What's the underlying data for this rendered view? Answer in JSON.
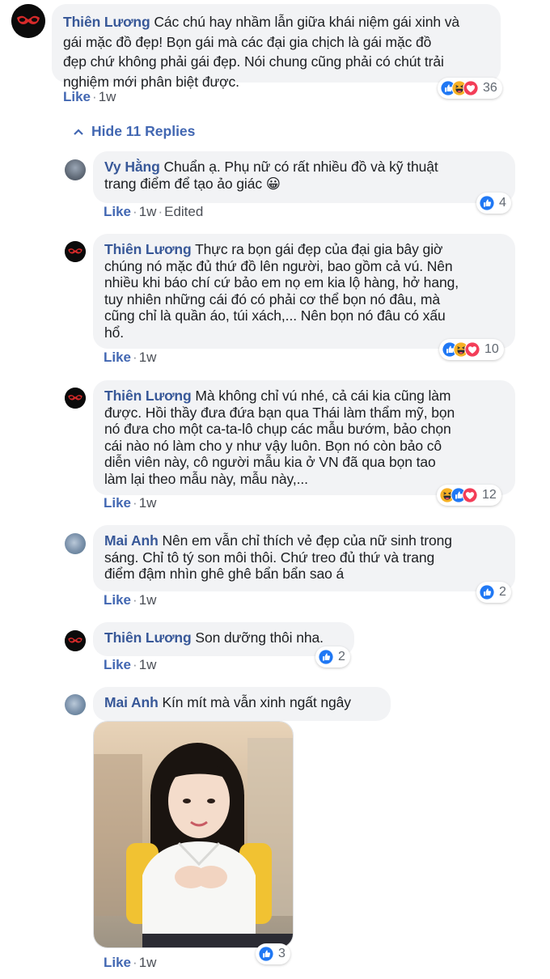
{
  "top_comment": {
    "author": "Thiên Lương",
    "text": "Các chú hay nhầm lẫn giữa khái niệm gái xinh và gái mặc đồ đẹp! Bọn gái mà các đại gia chịch là gái mặc đồ đẹp chứ không phải gái đẹp. Nói chung cũng phải có chút trải nghiệm mới phân biệt được.",
    "lines": [
      "Các chú hay nhầm lẫn giữa khái niệm gái xinh và",
      "gái mặc đồ đẹp! Bọn gái mà các đại gia chịch là gái mặc đồ",
      "đẹp chứ không phải gái đẹp. Nói chung cũng phải có chút trải",
      "nghiệm mới phân biệt được."
    ],
    "like_label": "Like",
    "time": "1w",
    "reactions": [
      "like-icon",
      "haha-icon",
      "love-icon"
    ],
    "reaction_count": "36"
  },
  "hide_replies_label": "Hide 11 Replies",
  "replies": [
    {
      "author": "Vy Hằng",
      "lines": [
        "Chuẩn ạ. Phụ nữ có rất nhiều đồ và kỹ thuật",
        "trang điểm để tạo ảo giác 😀"
      ],
      "like_label": "Like",
      "time": "1w",
      "edited_label": "Edited",
      "reactions": [
        "like-icon"
      ],
      "reaction_count": "4"
    },
    {
      "author": "Thiên Lương",
      "lines": [
        "Thực ra bọn gái đẹp của đại gia bây giờ",
        "chúng nó mặc đủ thứ đồ lên người, bao gồm cả vú. Nên",
        "nhiều khi báo chí cứ bảo em nọ em kia lộ hàng, hở hang,",
        "tuy nhiên những cái đó có phải cơ thể bọn nó đâu, mà",
        "cũng chỉ là quần áo, túi xách,... Nên bọn nó đâu có xấu",
        "hổ."
      ],
      "like_label": "Like",
      "time": "1w",
      "reactions": [
        "like-icon",
        "haha-icon",
        "love-icon"
      ],
      "reaction_count": "10"
    },
    {
      "author": "Thiên Lương",
      "lines": [
        "Mà không chỉ vú nhé, cả cái kia cũng làm",
        "được. Hồi thầy đưa đứa bạn qua Thái làm thẩm mỹ, bọn",
        "nó đưa cho một ca-ta-lô chụp các mẫu bướm, bảo chọn",
        "cái nào nó làm cho y như vậy luôn. Bọn nó còn bảo cô",
        "diễn viên này, cô người mẫu kia ở VN đã qua bọn tao",
        "làm lại theo mẫu này, mẫu này,..."
      ],
      "like_label": "Like",
      "time": "1w",
      "reactions": [
        "haha-icon",
        "like-icon",
        "love-icon"
      ],
      "reaction_count": "12"
    },
    {
      "author": "Mai Anh",
      "lines": [
        "Nên em vẫn chỉ thích vẻ đẹp của nữ sinh trong",
        "sáng. Chỉ tô tý son môi thôi. Chứ treo đủ thứ và trang",
        "điểm đậm nhìn ghê ghê bẩn bẩn sao á"
      ],
      "like_label": "Like",
      "time": "1w",
      "reactions": [
        "like-icon"
      ],
      "reaction_count": "2"
    },
    {
      "author": "Thiên Lương",
      "lines": [
        "Son dưỡng thôi nha."
      ],
      "like_label": "Like",
      "time": "1w",
      "reactions": [
        "like-icon"
      ],
      "reaction_count": "2"
    },
    {
      "author": "Mai Anh",
      "lines": [
        "Kín mít mà vẫn xinh ngất ngây"
      ],
      "like_label": "Like",
      "time": "1w",
      "reactions": [
        "like-icon"
      ],
      "reaction_count": "3"
    }
  ],
  "colors": {
    "name": "#385898",
    "link": "#4267b2",
    "bubble": "#f2f3f5",
    "like_blue": "#2078f4",
    "haha_yellow": "#f7b125",
    "love_red": "#f33e58"
  }
}
